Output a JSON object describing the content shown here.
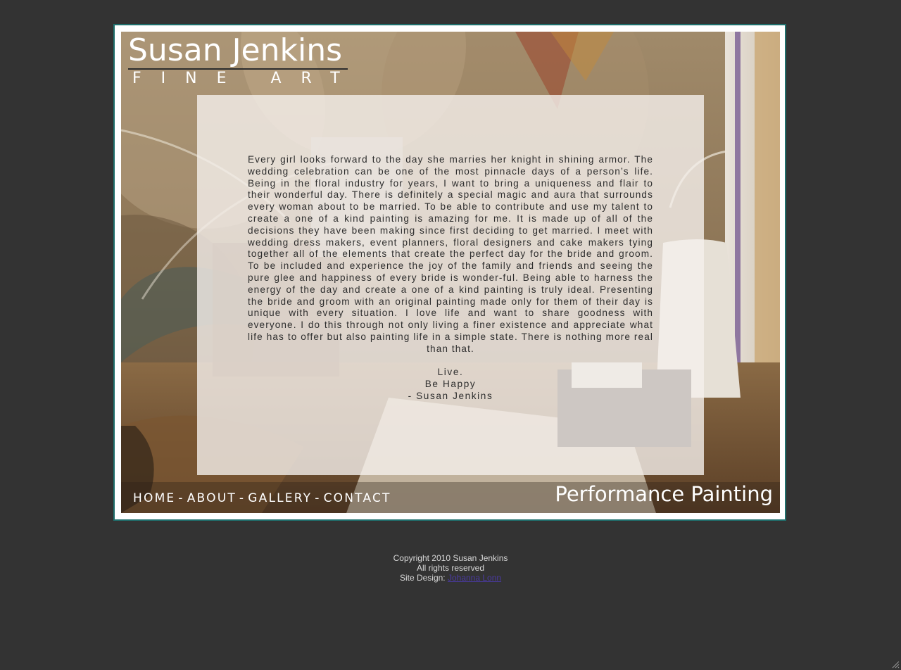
{
  "brand": {
    "name": "Susan Jenkins",
    "subtitle": "FINE ART"
  },
  "story": {
    "body": "Every girl looks forward to the day she marries her knight in shining armor. The wedding celebration can be one of the most pinnacle days of a person’s life. Being in the floral industry for years, I want to bring a uniqueness and flair to their wonderful day. There is definitely a special magic and aura that surrounds every woman about to be married. To be able to contribute and use my talent to create a one of a kind painting is amazing for me. It is made up of all of the decisions they have been making since first deciding to get married. I meet with wedding dress makers, event planners, floral designers and cake makers tying together all of the elements that create the perfect day for the bride and groom. To be included and experience the joy of the family and friends and seeing the pure glee and happiness of every bride is wonder-ful. Being able to harness the energy of the day and create a one of a kind painting is truly ideal. Presenting the bride and groom with an original painting made only for them of their day is unique with every situation. I love life and want to share goodness with everyone. I do this through not only living a finer existence and appreciate what life has to offer but also painting life in a simple state. There is nothing more real than that.",
    "signoff_1": "Live.",
    "signoff_2": "Be Happy",
    "signoff_3": "- Susan Jenkins"
  },
  "nav": {
    "home": "HOME",
    "about": "ABOUT",
    "gallery": "GALLERY",
    "contact": "CONTACT",
    "separator": "-"
  },
  "tagline": "Performance Painting",
  "footer": {
    "copyright": "Copyright 2010 Susan Jenkins",
    "rights": "All rights reserved",
    "design_label": "Site Design:",
    "designer": "Johanna Lonn"
  },
  "colors": {
    "page_background": "#333333",
    "frame_border": "#1f6f6c",
    "link_color": "#4a3aa0"
  }
}
